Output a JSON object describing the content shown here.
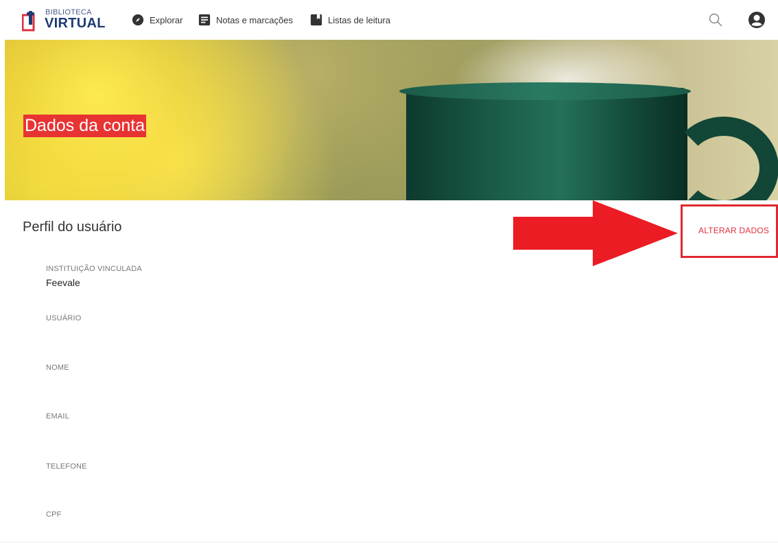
{
  "app": {
    "logo_small": "BIBLIOTECA",
    "logo_big": "VIRTUAL"
  },
  "nav": {
    "explore": "Explorar",
    "notes": "Notas e marcações",
    "lists": "Listas de leitura"
  },
  "banner": {
    "title": "Dados da conta"
  },
  "profile": {
    "title": "Perfil do usuário",
    "edit_label": "ALTERAR DADOS",
    "fields": [
      {
        "label": "INSTITUIÇÃO VINCULADA",
        "value": "Feevale"
      },
      {
        "label": "USUÁRIO",
        "value": ""
      },
      {
        "label": "NOME",
        "value": ""
      },
      {
        "label": "EMAIL",
        "value": ""
      },
      {
        "label": "TELEFONE",
        "value": ""
      },
      {
        "label": "CPF",
        "value": ""
      }
    ]
  },
  "colors": {
    "accent": "#e02f3e",
    "brand": "#1e3a72",
    "highlight": "#e0272e"
  }
}
